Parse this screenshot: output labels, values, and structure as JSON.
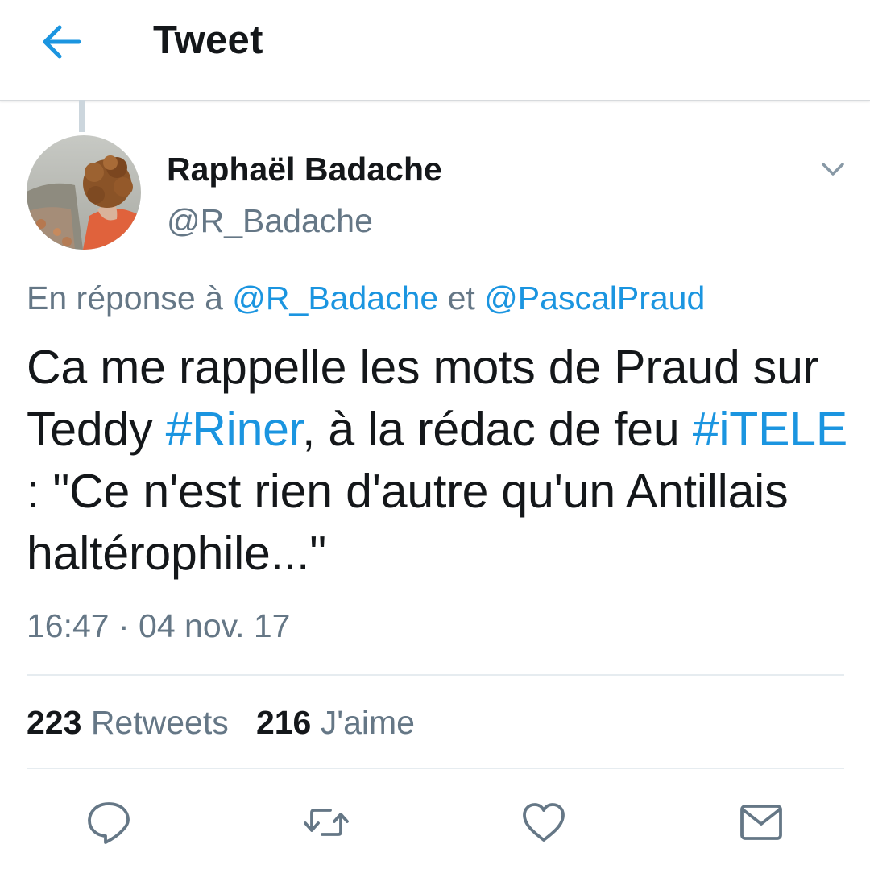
{
  "header": {
    "title": "Tweet",
    "back_icon": "arrow-left-icon",
    "accent": "#1b95e0"
  },
  "tweet": {
    "author_name": "Raphaël Badache",
    "author_handle": "@R_Badache",
    "reply_prefix": "En réponse à ",
    "reply_mention_1": "@R_Badache",
    "reply_joiner": " et ",
    "reply_mention_2": "@PascalPraud",
    "text_part_1": "Ca me rappelle les mots de Praud sur Teddy ",
    "hashtag_1": "#Riner",
    "text_part_2": ", à la rédac de feu ",
    "hashtag_2": "#iTELE",
    "text_part_3": " : \"Ce n'est rien d'autre qu'un Antillais haltérophile...\"",
    "timestamp": "16:47 · 04 nov. 17",
    "retweets_count": "223",
    "retweets_label": "Retweets",
    "likes_count": "216",
    "likes_label": "J'aime"
  },
  "actions": {
    "reply_icon": "reply-bubble-icon",
    "retweet_icon": "retweet-icon",
    "like_icon": "heart-icon",
    "message_icon": "envelope-icon"
  },
  "colors": {
    "link": "#1b95e0",
    "secondary_text": "#657786",
    "primary_text": "#14171a",
    "icon_gray": "#657786"
  }
}
